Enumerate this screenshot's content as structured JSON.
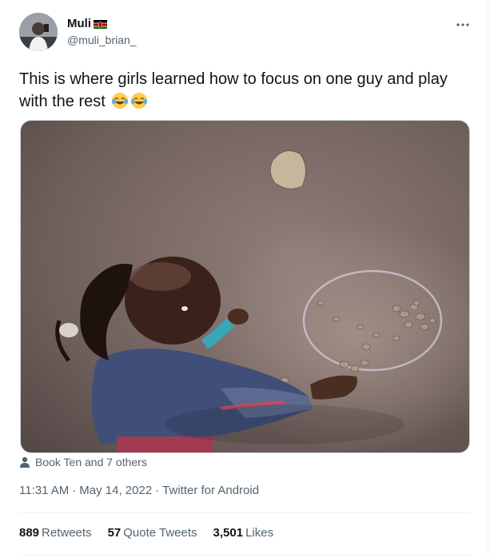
{
  "user": {
    "display_name": "Muli",
    "handle": "@muli_brian_",
    "flag_icon": "kenya-flag-icon"
  },
  "tweet": {
    "text": "This is where girls learned how to focus on one guy and play with the rest",
    "emoji": [
      "face-with-tears-of-joy",
      "face-with-tears-of-joy"
    ]
  },
  "media": {
    "tagged_text": "Book Ten and 7 others"
  },
  "meta": {
    "time": "11:31 AM",
    "separator": "·",
    "date": "May 14, 2022",
    "source": "Twitter for Android"
  },
  "stats": [
    {
      "count": "889",
      "label": "Retweets"
    },
    {
      "count": "57",
      "label": "Quote Tweets"
    },
    {
      "count": "3,501",
      "label": "Likes"
    }
  ],
  "colors": {
    "text": "#0f1419",
    "secondary": "#536471",
    "border": "#eff3f4"
  }
}
